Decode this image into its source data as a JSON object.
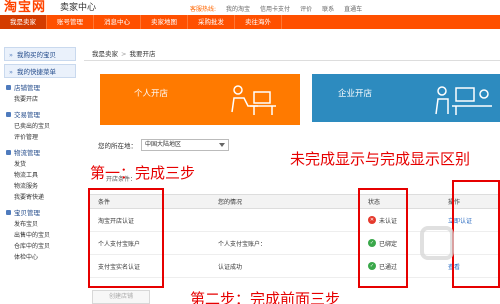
{
  "header": {
    "logo": "淘宝网",
    "logo_sub": "卖家中心",
    "links": [
      "客服热线:",
      "我的淘宝",
      "信用卡支付",
      "评价",
      "联系",
      "直通车"
    ]
  },
  "nav": {
    "items": [
      "我是卖家",
      "账号管理",
      "消息中心",
      "卖家地图",
      "采购批发",
      "卖往海外"
    ]
  },
  "sidebar": {
    "head_items": [
      "我购买的宝贝",
      "我的快捷菜单"
    ],
    "groups": [
      {
        "title": "店铺管理",
        "links": [
          "我要开店"
        ]
      },
      {
        "title": "交易管理",
        "links": [
          "已卖出的宝贝",
          "评价管理"
        ]
      },
      {
        "title": "物流管理",
        "links": [
          "发货",
          "物流工具",
          "物流服务",
          "我要寄快递"
        ]
      },
      {
        "title": "宝贝管理",
        "links": [
          "发布宝贝",
          "出售中的宝贝",
          "仓库中的宝贝",
          "体检中心"
        ]
      }
    ]
  },
  "breadcrumb": {
    "items": [
      "我是卖家",
      "我要开店"
    ],
    "sep": ">"
  },
  "tabs": {
    "personal": "个人开店",
    "enterprise": "企业开店"
  },
  "location": {
    "label": "您的所在地：",
    "value": "中国大陆地区"
  },
  "conditions_label": "开店条件：",
  "table": {
    "headers": [
      "条件",
      "您的情况",
      "状态",
      "操作"
    ],
    "rows": [
      {
        "condition": "淘宝开店认证",
        "situation": "",
        "status": "未认证",
        "status_type": "no",
        "op": "立即认证"
      },
      {
        "condition": "个人支付宝账户",
        "situation": "个人支付宝账户：",
        "status": "已绑定",
        "status_type": "ok",
        "op": ""
      },
      {
        "condition": "支付宝实名认证",
        "situation": "认证成功",
        "status": "已通过",
        "status_type": "ok",
        "op": "查看"
      }
    ]
  },
  "start_button": "创建店铺",
  "annotations": {
    "step_one": "第一：完成三步",
    "status_note": "未完成显示与完成显示区别",
    "step_two": "第二步：完成前面三步"
  },
  "colors": {
    "brand_orange": "#ff5000",
    "personal_tab": "#ff7a00",
    "enterprise_tab": "#2d8bbf",
    "annotation_red": "#e60000",
    "status_fail": "#e53a2d",
    "status_ok": "#3aa84a"
  }
}
